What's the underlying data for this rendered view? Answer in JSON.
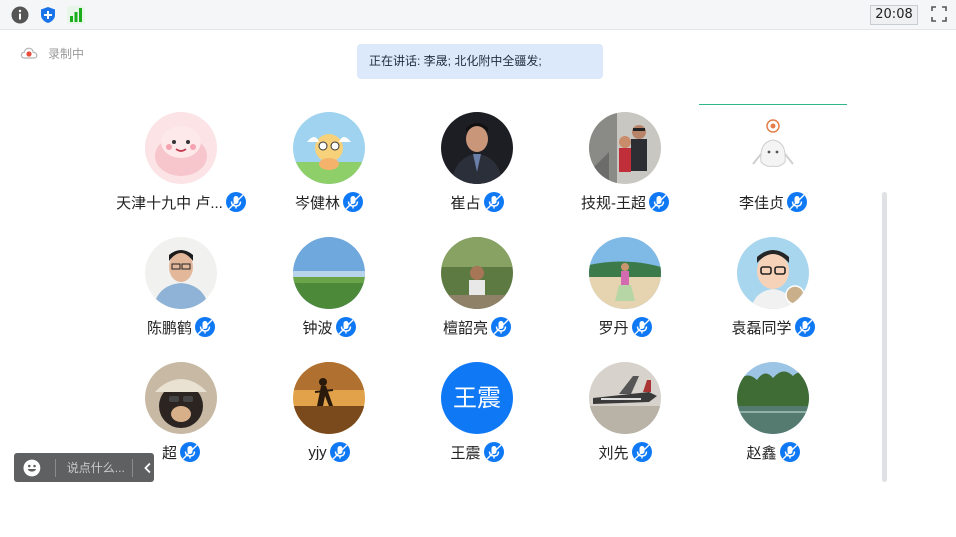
{
  "toolbar": {
    "clock": "20:08",
    "icons": [
      "info-icon",
      "shield-plus-icon",
      "signal-bars-icon",
      "fullscreen-icon"
    ]
  },
  "recording": {
    "label": "录制中"
  },
  "speaking_banner": {
    "text": "正在讲话: 李晟; 北化附中全疆发;"
  },
  "participants": [
    {
      "name": "天津十九中  卢...",
      "avatar": "pink-blob"
    },
    {
      "name": "岑健林",
      "avatar": "cupid-cartoon"
    },
    {
      "name": "崔占",
      "avatar": "man-suit"
    },
    {
      "name": "技规-王超",
      "avatar": "couple-stairs"
    },
    {
      "name": "李佳贞",
      "avatar": "ghost-doodle"
    },
    {
      "name": "陈鹏鹤",
      "avatar": "young-man-glasses"
    },
    {
      "name": "钟波",
      "avatar": "green-field-sky"
    },
    {
      "name": "檀韶亮",
      "avatar": "man-outdoor"
    },
    {
      "name": "罗丹",
      "avatar": "beach-person"
    },
    {
      "name": "袁磊同学",
      "avatar": "cartoon-man-glasses"
    },
    {
      "name": "超",
      "avatar": "dog-hat"
    },
    {
      "name": "yjy",
      "avatar": "sunset-silhouette"
    },
    {
      "name": "王震",
      "avatar": "text",
      "avatar_text": "王震"
    },
    {
      "name": "刘先",
      "avatar": "airplane"
    },
    {
      "name": "赵鑫",
      "avatar": "lake-trees"
    }
  ],
  "chat": {
    "placeholder": "说点什么..."
  },
  "colors": {
    "accent_blue": "#0f79f5",
    "banner_bg": "#dce9fa",
    "divider_green": "#2fb58a"
  }
}
